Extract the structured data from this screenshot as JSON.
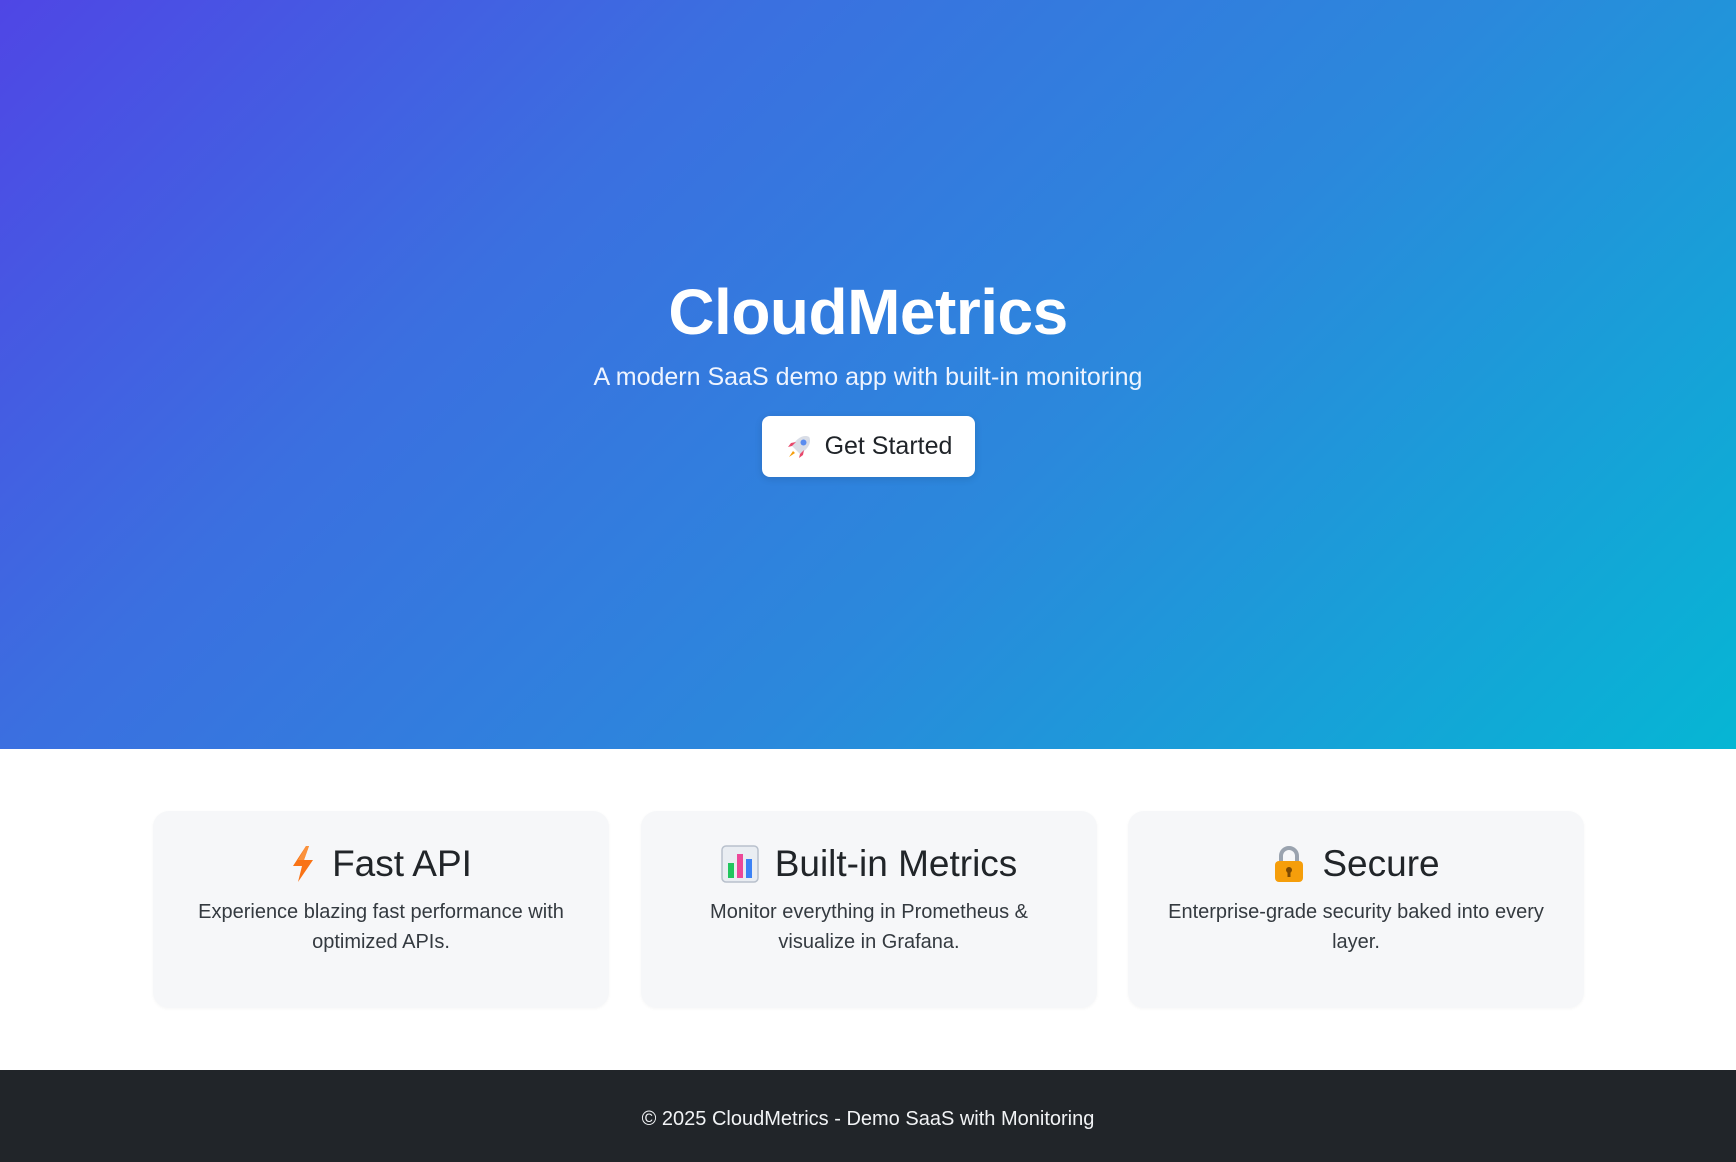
{
  "hero": {
    "title": "CloudMetrics",
    "subtitle": "A modern SaaS demo app with built-in monitoring",
    "cta_label": "Get Started",
    "cta_icon": "rocket-icon",
    "gradient": [
      "#4f46e5",
      "#06b6d4"
    ]
  },
  "features": [
    {
      "icon": "lightning-icon",
      "title": "Fast API",
      "description": "Experience blazing fast performance with optimized APIs."
    },
    {
      "icon": "bar-chart-icon",
      "title": "Built-in Metrics",
      "description": "Monitor everything in Prometheus & visualize in Grafana."
    },
    {
      "icon": "lock-icon",
      "title": "Secure",
      "description": "Enterprise-grade security baked into every layer."
    }
  ],
  "footer": {
    "text": "© 2025 CloudMetrics - Demo SaaS with Monitoring",
    "background": "#212529"
  }
}
